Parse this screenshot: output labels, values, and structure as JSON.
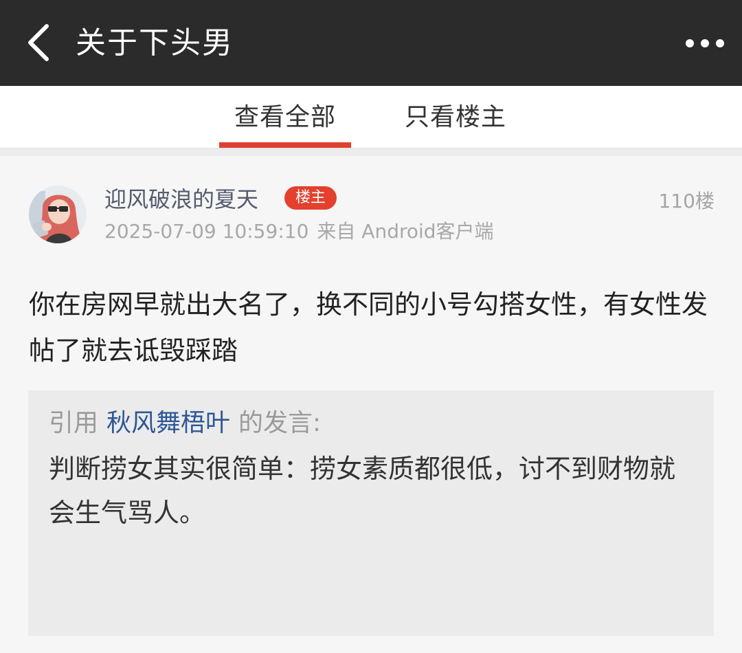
{
  "header": {
    "title": "关于下头男",
    "back_icon": "chevron-left-icon",
    "more_icon": "more-horizontal-icon"
  },
  "tabs": [
    {
      "label": "查看全部",
      "active": true
    },
    {
      "label": "只看楼主",
      "active": false
    }
  ],
  "post": {
    "username": "迎风破浪的夏天",
    "badge": "楼主",
    "floor": "110楼",
    "timestamp": "2025-07-09 10:59:10",
    "source": "来自 Android客户端",
    "content": "你在房网早就出大名了，换不同的小号勾搭女性，有女性发帖了就去诋毁踩踏",
    "quote": {
      "prefix": "引用",
      "user": "秋风舞梧叶",
      "suffix": "的发言:",
      "text": "判断捞女其实很简单：捞女素质都很低，讨不到财物就会生气骂人。"
    }
  },
  "colors": {
    "topbar": "#2b2b2b",
    "accent": "#e0402e",
    "quote_user": "#2e5796"
  }
}
